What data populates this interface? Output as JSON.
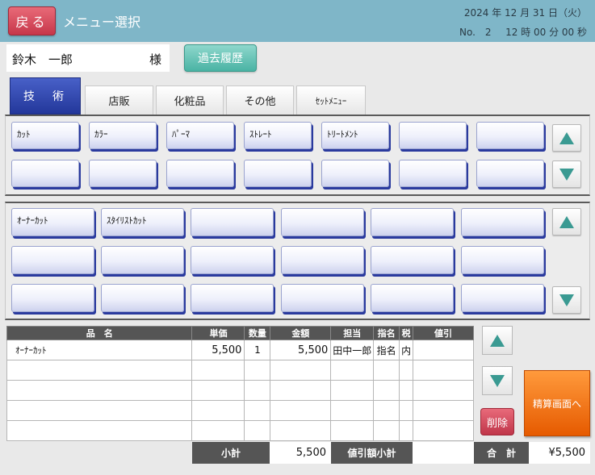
{
  "header": {
    "back_label": "戻る",
    "title": "メニュー選択",
    "date": "2024 年 12 月 31 日（火）",
    "tx_no": "No.　2",
    "time": "12 時 00 分 00 秒"
  },
  "customer": {
    "name": "鈴木　一郎",
    "honorific": "様",
    "history_label": "過去履歴"
  },
  "tabs": [
    "技　術",
    "店販",
    "化粧品",
    "その他",
    "ｾｯﾄﾒﾆｭｰ"
  ],
  "menu_panel1": [
    "ｶｯﾄ",
    "ｶﾗｰ",
    "ﾊﾟｰﾏ",
    "ｽﾄﾚｰﾄ",
    "ﾄﾘｰﾄﾒﾝﾄ",
    "",
    "",
    "",
    "",
    "",
    "",
    "",
    "",
    ""
  ],
  "menu_panel2": [
    "ｵｰﾅｰｶｯﾄ",
    "ｽﾀｲﾘｽﾄｶｯﾄ",
    "",
    "",
    "",
    "",
    "",
    "",
    "",
    "",
    "",
    "",
    "",
    "",
    "",
    "",
    "",
    ""
  ],
  "table": {
    "headers": [
      "品　名",
      "単価",
      "数量",
      "金額",
      "担当",
      "指名",
      "税",
      "値引"
    ],
    "rows": [
      [
        "ｵｰﾅｰｶｯﾄ",
        "5,500",
        "1",
        "5,500",
        "田中一郎",
        "指名",
        "内",
        ""
      ],
      [
        "",
        "",
        "",
        "",
        "",
        "",
        "",
        ""
      ],
      [
        "",
        "",
        "",
        "",
        "",
        "",
        "",
        ""
      ],
      [
        "",
        "",
        "",
        "",
        "",
        "",
        "",
        ""
      ],
      [
        "",
        "",
        "",
        "",
        "",
        "",
        "",
        ""
      ]
    ]
  },
  "footer": {
    "subtotal_label": "小計",
    "subtotal_value": "5,500",
    "discount_label": "値引額小計",
    "discount_value": "",
    "total_label": "合　計",
    "total_value": "¥5,500"
  },
  "actions": {
    "delete_label": "削除",
    "checkout_label": "精算画面へ"
  },
  "colors": {
    "header": "#7fb6c8",
    "accent_blue": "#23379a",
    "checkout": "#e65a00",
    "delete": "#c0364a",
    "arrow": "#3a9a92"
  }
}
